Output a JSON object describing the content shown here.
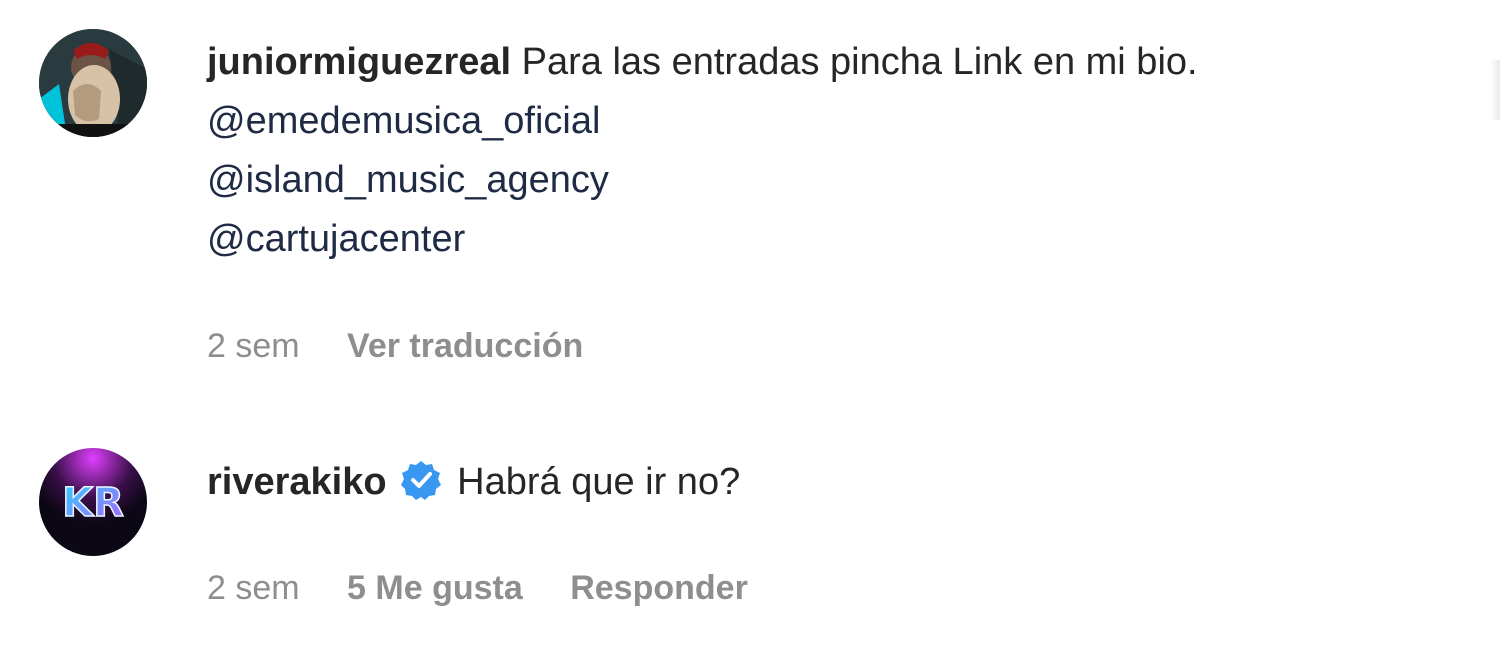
{
  "comments": [
    {
      "username": "juniormiguezreal",
      "text": "Para las entradas pincha Link en mi bio.",
      "mentions": [
        "@emedemusica_oficial",
        "@island_music_agency",
        "@cartujacenter"
      ],
      "time": "2 sem",
      "action": "Ver traducción",
      "avatar_icon": "profile-photo"
    },
    {
      "username": "riverakiko",
      "verified": true,
      "text": "Habrá que ir no?",
      "time": "2 sem",
      "likes": "5 Me gusta",
      "action": "Responder",
      "avatar_icon": "profile-photo",
      "avatar_letters": "KR"
    }
  ],
  "colors": {
    "text": "#262626",
    "muted": "#8e8e8e",
    "verified": "#3897f0"
  }
}
